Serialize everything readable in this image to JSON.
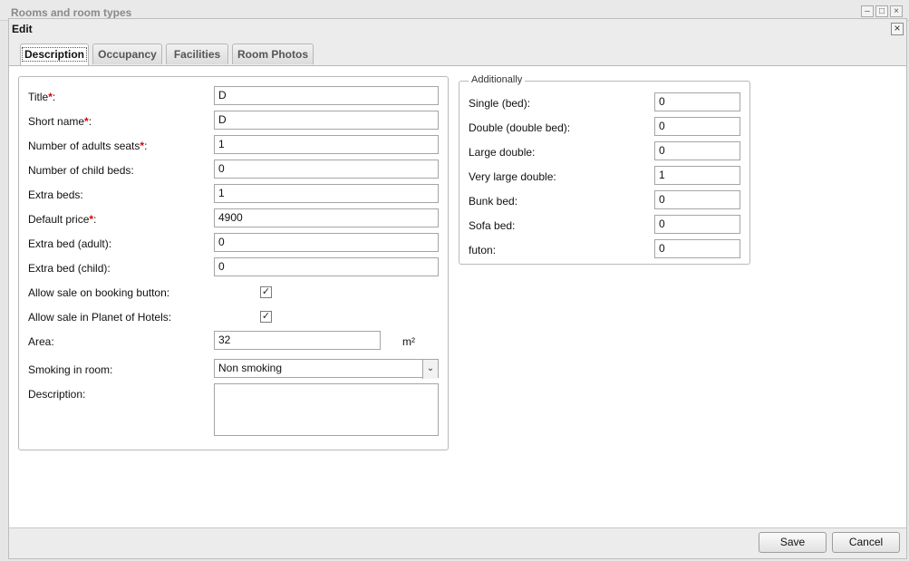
{
  "background_window": {
    "title": "Rooms and room types",
    "minimize": "–",
    "maximize": "□",
    "close": "×"
  },
  "dialog": {
    "title": "Edit",
    "close": "×"
  },
  "tabs": [
    {
      "label": "Description"
    },
    {
      "label": "Occupancy"
    },
    {
      "label": "Facilities"
    },
    {
      "label": "Room Photos"
    }
  ],
  "form": {
    "title": {
      "label": "Title",
      "required": "*",
      "colon": ":",
      "value": "D"
    },
    "short_name": {
      "label": "Short name",
      "required": "*",
      "colon": ":",
      "value": "D"
    },
    "adults": {
      "label": "Number of adults seats",
      "required": "*",
      "colon": ":",
      "value": "1"
    },
    "child_beds": {
      "label": "Number of child beds:",
      "value": "0"
    },
    "extra_beds": {
      "label": "Extra beds:",
      "value": "1"
    },
    "default_price": {
      "label": "Default price",
      "required": "*",
      "colon": ":",
      "value": "4900"
    },
    "extra_bed_adult": {
      "label": "Extra bed (adult):",
      "value": "0"
    },
    "extra_bed_child": {
      "label": "Extra bed (child):",
      "value": "0"
    },
    "allow_booking": {
      "label": "Allow sale on booking button:",
      "check": "✓"
    },
    "allow_planet": {
      "label": "Allow sale in Planet of Hotels:",
      "check": "✓"
    },
    "area": {
      "label": "Area:",
      "value": "32",
      "unit": "m²"
    },
    "smoking": {
      "label": "Smoking in room:",
      "value": "Non smoking",
      "arrow": "⌄"
    },
    "description": {
      "label": "Description:",
      "value": ""
    }
  },
  "additionally": {
    "legend": "Additionally",
    "fields": [
      {
        "label": "Single (bed):",
        "value": "0"
      },
      {
        "label": "Double (double bed):",
        "value": "0"
      },
      {
        "label": "Large double:",
        "value": "0"
      },
      {
        "label": "Very large double:",
        "value": "1"
      },
      {
        "label": "Bunk bed:",
        "value": "0"
      },
      {
        "label": "Sofa bed:",
        "value": "0"
      },
      {
        "label": "futon:",
        "value": "0"
      }
    ]
  },
  "footer": {
    "save": "Save",
    "cancel": "Cancel"
  }
}
